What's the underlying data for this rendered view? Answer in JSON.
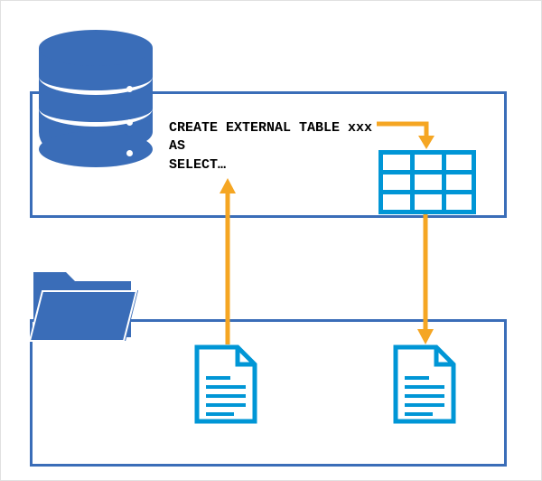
{
  "sql": {
    "line1": "CREATE EXTERNAL TABLE xxx",
    "line2": "AS",
    "line3": "SELECT…"
  },
  "icons": {
    "database": "database-icon",
    "folder": "folder-icon",
    "table": "table-grid-icon",
    "documentLeft": "document-icon",
    "documentRight": "document-icon",
    "arrowUp": "arrow-up-icon",
    "arrowDown": "arrow-down-icon",
    "arrowElbow": "arrow-elbow-icon"
  },
  "colors": {
    "darkBlue": "#3a6db8",
    "lightBlue": "#0096d6",
    "arrow": "#f5a623"
  }
}
